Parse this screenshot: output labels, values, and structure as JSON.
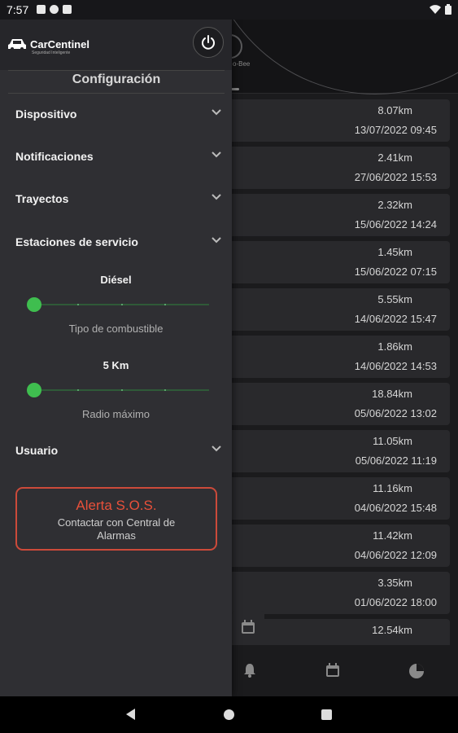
{
  "status_bar": {
    "time": "7:57"
  },
  "drawer": {
    "brand": "CarCentinel",
    "brand_tagline": "Seguridad Inteligente",
    "title": "Configuración",
    "menu": [
      {
        "label": "Dispositivo"
      },
      {
        "label": "Notificaciones"
      },
      {
        "label": "Trayectos"
      },
      {
        "label": "Estaciones de servicio"
      }
    ],
    "fuel_slider": {
      "value": "Diésel",
      "caption": "Tipo de combustible",
      "level": 0
    },
    "radius_slider": {
      "value": "5 Km",
      "caption": "Radio máximo",
      "level": 0
    },
    "user_menu": {
      "label": "Usuario"
    },
    "sos": {
      "title": "Alerta S.O.S.",
      "subtitle": "Contactar con Central de Alarmas"
    }
  },
  "background": {
    "gauge_label": "o-Bee",
    "trips": [
      {
        "distance": "8.07km",
        "date": "13/07/2022 09:45"
      },
      {
        "distance": "2.41km",
        "date": "27/06/2022 15:53"
      },
      {
        "distance": "2.32km",
        "date": "15/06/2022 14:24"
      },
      {
        "distance": "1.45km",
        "date": "15/06/2022 07:15"
      },
      {
        "distance": "5.55km",
        "date": "14/06/2022 15:47"
      },
      {
        "distance": "1.86km",
        "date": "14/06/2022 14:53"
      },
      {
        "distance": "18.84km",
        "date": "05/06/2022 13:02"
      },
      {
        "distance": "11.05km",
        "date": "05/06/2022 11:19"
      },
      {
        "distance": "11.16km",
        "date": "04/06/2022 15:48"
      },
      {
        "distance": "11.42km",
        "date": "04/06/2022 12:09"
      },
      {
        "distance": "3.35km",
        "date": "01/06/2022 18:00"
      },
      {
        "distance": "12.54km",
        "date": ""
      }
    ]
  },
  "colors": {
    "accent_green": "#3fbe4f",
    "sos_red": "#e8503a",
    "drawer_bg": "#2f2f33"
  },
  "icons": [
    "power-icon",
    "chevron-down-icon",
    "calendar-icon",
    "bell-icon",
    "pie-chart-icon",
    "wifi-icon",
    "battery-icon",
    "car-icon"
  ]
}
